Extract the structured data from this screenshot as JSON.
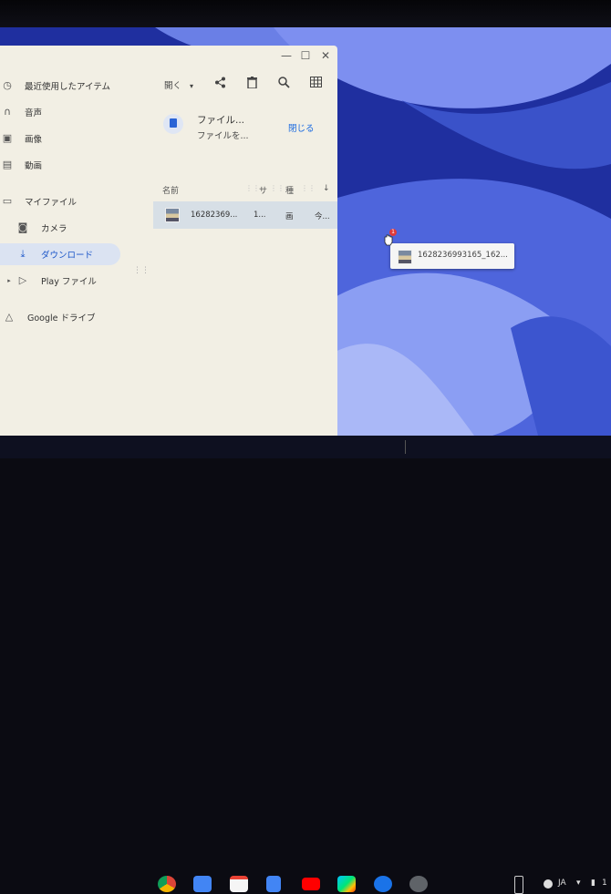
{
  "files_window": {
    "controls": {
      "minimize": "—",
      "maximize": "☐",
      "close": "✕"
    },
    "sidebar": {
      "items": [
        {
          "label": "最近使用したアイテム",
          "icon": "clock-icon"
        },
        {
          "label": "音声",
          "icon": "headphones-icon"
        },
        {
          "label": "画像",
          "icon": "image-icon"
        },
        {
          "label": "動画",
          "icon": "film-icon"
        },
        {
          "label": "マイファイル",
          "icon": "laptop-icon"
        },
        {
          "label": "カメラ",
          "icon": "camera-icon"
        },
        {
          "label": "ダウンロード",
          "icon": "download-icon",
          "selected": true
        },
        {
          "label": "Play ファイル",
          "icon": "play-store-icon"
        },
        {
          "label": "Google ドライブ",
          "icon": "drive-icon"
        }
      ]
    },
    "toolbar": {
      "open_label": "開く",
      "open_chevron": "▾",
      "icons": [
        "share-icon",
        "delete-icon",
        "search-icon",
        "grid-view-icon"
      ]
    },
    "banner": {
      "line1": "ファイル...",
      "line2": "ファイルを...",
      "close_label": "閉じる"
    },
    "columns": {
      "name": "名前",
      "size": "サ",
      "type": "種",
      "sort": "↓"
    },
    "rows": [
      {
        "name": "16282369...",
        "size": "1...",
        "type": "画",
        "date": "今..."
      }
    ]
  },
  "drag_preview": {
    "filename": "1628236993165_162...",
    "count_badge": "1"
  },
  "shelf": {
    "apps": [
      "chrome-icon",
      "files-icon",
      "gmail-icon",
      "docs-icon",
      "youtube-icon",
      "play-store-icon",
      "messages-icon",
      "settings-icon"
    ],
    "status": {
      "ime": "JA",
      "time": "1"
    },
    "colors": {
      "accent": "#1a6ae0",
      "selected_bg": "#dbe3f2"
    }
  }
}
